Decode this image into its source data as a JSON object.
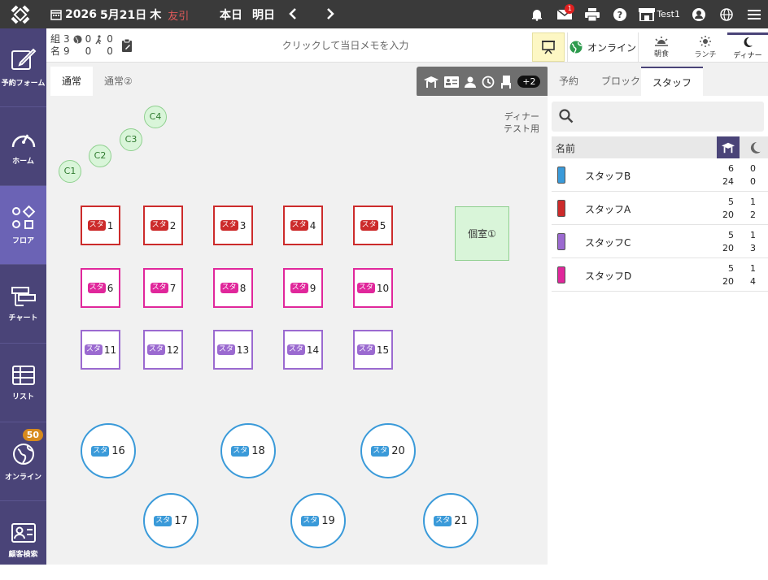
{
  "topbar": {
    "date_year": "2026",
    "date_md": "5月21日",
    "weekday": "木",
    "rokuyo": "友引",
    "today_label": "本日",
    "tomorrow_label": "明日",
    "notification_count": "1",
    "user_name": "Test1"
  },
  "sidebar": {
    "items": [
      {
        "label": "予約フォーム",
        "icon": "edit-icon"
      },
      {
        "label": "ホーム",
        "icon": "gauge-icon"
      },
      {
        "label": "フロア",
        "icon": "floor-icon"
      },
      {
        "label": "チャート",
        "icon": "chart-icon"
      },
      {
        "label": "リスト",
        "icon": "list-icon"
      },
      {
        "label": "オンライン",
        "icon": "online-icon",
        "badge": "50"
      },
      {
        "label": "顧客検索",
        "icon": "customer-icon"
      }
    ]
  },
  "subbar": {
    "counts": {
      "groups_label": "組",
      "groups": "3",
      "groups_web": "0",
      "groups_walk": "0",
      "people_label": "名",
      "people": "9",
      "people_web": "0",
      "people_walk": "0"
    },
    "memo_placeholder": "クリックして当日メモを入力",
    "online_label": "オンライン",
    "meals": [
      "朝食",
      "ランチ",
      "ディナー"
    ]
  },
  "floor_tabs": [
    "通常",
    "通常②"
  ],
  "filter_extra": "+2",
  "floor_note": [
    "ディナー",
    "テスト用"
  ],
  "c_seats": [
    "C1",
    "C2",
    "C3",
    "C4"
  ],
  "staff_tag": "スタ",
  "tables_red": [
    "1",
    "2",
    "3",
    "4",
    "5"
  ],
  "tables_pink": [
    "6",
    "7",
    "8",
    "9",
    "10"
  ],
  "tables_purple": [
    "11",
    "12",
    "13",
    "14",
    "15"
  ],
  "tables_round_top": [
    "16",
    "18",
    "20"
  ],
  "tables_round_bottom": [
    "17",
    "19",
    "21"
  ],
  "private_room": "個室①",
  "right_tabs": [
    "予約",
    "ブロック",
    "スタッフ"
  ],
  "staff_header": "名前",
  "staff": [
    {
      "name": "スタッフB",
      "color": "#3a9ad9",
      "a": "6",
      "b": "0",
      "c": "24",
      "d": "0"
    },
    {
      "name": "スタッフA",
      "color": "#cc2b2b",
      "a": "5",
      "b": "1",
      "c": "20",
      "d": "2"
    },
    {
      "name": "スタッフC",
      "color": "#9b6ad0",
      "a": "5",
      "b": "1",
      "c": "20",
      "d": "3"
    },
    {
      "name": "スタッフD",
      "color": "#e0279b",
      "a": "5",
      "b": "1",
      "c": "20",
      "d": "4"
    }
  ]
}
